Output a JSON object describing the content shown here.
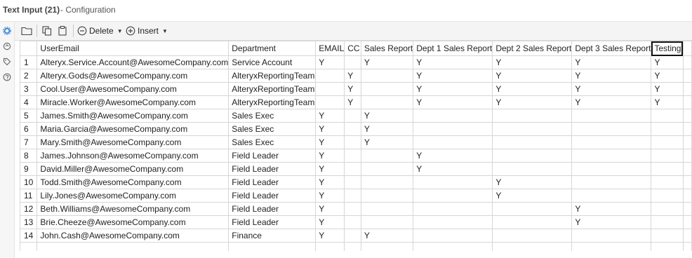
{
  "title": {
    "tool": "Text Input (21)",
    "subtitle": "- Configuration"
  },
  "left_icons": [
    "gear-icon",
    "refresh-icon",
    "tag-icon",
    "help-icon"
  ],
  "toolbar": {
    "delete_label": "Delete",
    "insert_label": "Insert"
  },
  "table": {
    "columns": [
      "UserEmail",
      "Department",
      "EMAIL",
      "CC",
      "Sales Report",
      "Dept 1 Sales Report",
      "Dept 2 Sales Report",
      "Dept 3 Sales Report",
      "Testing"
    ],
    "selected_column": "Testing",
    "rows": [
      [
        "1",
        "Alteryx.Service.Account@AwesomeCompany.com",
        "Service Account",
        "Y",
        "",
        "Y",
        "Y",
        "Y",
        "Y",
        "Y"
      ],
      [
        "2",
        "Alteryx.Gods@AwesomeCompany.com",
        "AlteryxReportingTeam",
        "",
        "Y",
        "",
        "Y",
        "Y",
        "Y",
        "Y"
      ],
      [
        "3",
        "Cool.User@AwesomeCompany.com",
        "AlteryxReportingTeam",
        "",
        "Y",
        "",
        "Y",
        "Y",
        "Y",
        "Y"
      ],
      [
        "4",
        "Miracle.Worker@AwesomeCompany.com",
        "AlteryxReportingTeam",
        "",
        "Y",
        "",
        "Y",
        "Y",
        "Y",
        "Y"
      ],
      [
        "5",
        "James.Smith@AwesomeCompany.com",
        "Sales Exec",
        "Y",
        "",
        "Y",
        "",
        "",
        "",
        ""
      ],
      [
        "6",
        "Maria.Garcia@AwesomeCompany.com",
        "Sales Exec",
        "Y",
        "",
        "Y",
        "",
        "",
        "",
        ""
      ],
      [
        "7",
        "Mary.Smith@AwesomeCompany.com",
        "Sales Exec",
        "Y",
        "",
        "Y",
        "",
        "",
        "",
        ""
      ],
      [
        "8",
        "James.Johnson@AwesomeCompany.com",
        "Field Leader",
        "Y",
        "",
        "",
        "Y",
        "",
        "",
        ""
      ],
      [
        "9",
        "David.Miller@AwesomeCompany.com",
        "Field Leader",
        "Y",
        "",
        "",
        "Y",
        "",
        "",
        ""
      ],
      [
        "10",
        "Todd.Smith@AwesomeCompany.com",
        "Field Leader",
        "Y",
        "",
        "",
        "",
        "Y",
        "",
        ""
      ],
      [
        "11",
        "Lily.Jones@AwesomeCompany.com",
        "Field Leader",
        "Y",
        "",
        "",
        "",
        "Y",
        "",
        ""
      ],
      [
        "12",
        "Beth.Williams@AwesomeCompany.com",
        "Field Leader",
        "Y",
        "",
        "",
        "",
        "",
        "Y",
        ""
      ],
      [
        "13",
        "Brie.Cheeze@AwesomeCompany.com",
        "Field Leader",
        "Y",
        "",
        "",
        "",
        "",
        "Y",
        ""
      ],
      [
        "14",
        "John.Cash@AwesomeCompany.com",
        "Finance",
        "Y",
        "",
        "Y",
        "",
        "",
        "",
        ""
      ]
    ]
  }
}
